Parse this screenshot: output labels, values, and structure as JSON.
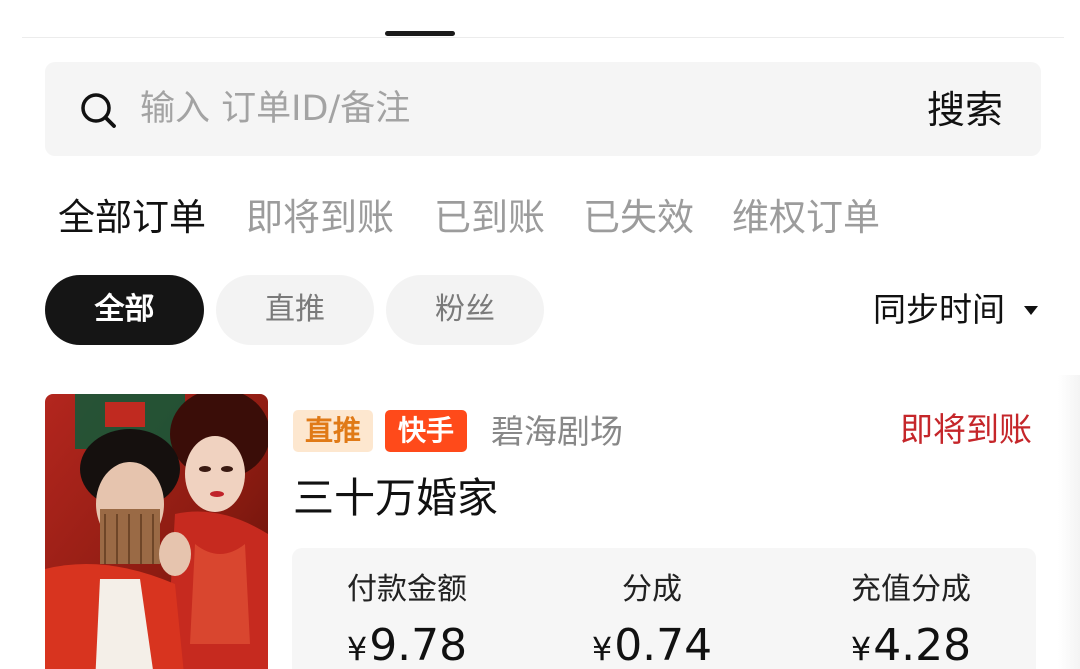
{
  "search": {
    "placeholder": "输入 订单ID/备注",
    "button_label": "搜索",
    "icon": "search-icon"
  },
  "status_tabs": [
    {
      "label": "全部订单",
      "active": true
    },
    {
      "label": "即将到账",
      "active": false
    },
    {
      "label": "已到账",
      "active": false
    },
    {
      "label": "已失效",
      "active": false
    },
    {
      "label": "维权订单",
      "active": false
    }
  ],
  "filter_chips": [
    {
      "label": "全部",
      "active": true
    },
    {
      "label": "直推",
      "active": false
    },
    {
      "label": "粉丝",
      "active": false
    }
  ],
  "sort": {
    "label": "同步时间",
    "icon": "caret-down-icon"
  },
  "order": {
    "tags": {
      "type": "直推",
      "platform": "快手"
    },
    "theater": "碧海剧场",
    "status": "即将到账",
    "title": "三十万婚家",
    "stats": [
      {
        "label": "付款金额",
        "currency": "¥",
        "value": "9.78"
      },
      {
        "label": "分成",
        "currency": "¥",
        "value": "0.74"
      },
      {
        "label": "充值分成",
        "currency": "¥",
        "value": "4.28"
      }
    ]
  },
  "colors": {
    "status_red": "#c5262a",
    "platform_orange": "#ff4a1a",
    "direct_tag_bg": "#fde7cf",
    "direct_tag_text": "#e07a17",
    "active_chip": "#151515"
  }
}
